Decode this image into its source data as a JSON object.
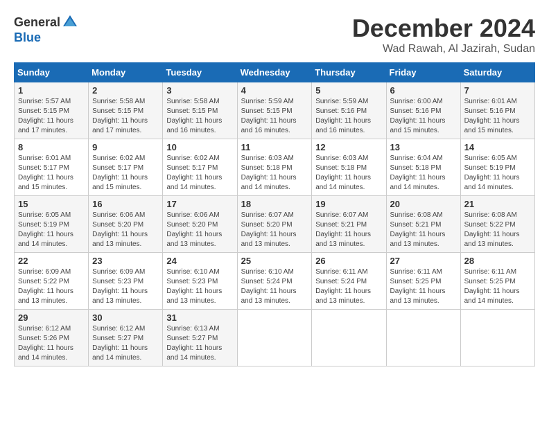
{
  "header": {
    "logo_general": "General",
    "logo_blue": "Blue",
    "month_title": "December 2024",
    "location": "Wad Rawah, Al Jazirah, Sudan"
  },
  "calendar": {
    "days_of_week": [
      "Sunday",
      "Monday",
      "Tuesday",
      "Wednesday",
      "Thursday",
      "Friday",
      "Saturday"
    ],
    "weeks": [
      [
        {
          "day": "1",
          "info": "Sunrise: 5:57 AM\nSunset: 5:15 PM\nDaylight: 11 hours and 17 minutes."
        },
        {
          "day": "2",
          "info": "Sunrise: 5:58 AM\nSunset: 5:15 PM\nDaylight: 11 hours and 17 minutes."
        },
        {
          "day": "3",
          "info": "Sunrise: 5:58 AM\nSunset: 5:15 PM\nDaylight: 11 hours and 16 minutes."
        },
        {
          "day": "4",
          "info": "Sunrise: 5:59 AM\nSunset: 5:15 PM\nDaylight: 11 hours and 16 minutes."
        },
        {
          "day": "5",
          "info": "Sunrise: 5:59 AM\nSunset: 5:16 PM\nDaylight: 11 hours and 16 minutes."
        },
        {
          "day": "6",
          "info": "Sunrise: 6:00 AM\nSunset: 5:16 PM\nDaylight: 11 hours and 15 minutes."
        },
        {
          "day": "7",
          "info": "Sunrise: 6:01 AM\nSunset: 5:16 PM\nDaylight: 11 hours and 15 minutes."
        }
      ],
      [
        {
          "day": "8",
          "info": "Sunrise: 6:01 AM\nSunset: 5:17 PM\nDaylight: 11 hours and 15 minutes."
        },
        {
          "day": "9",
          "info": "Sunrise: 6:02 AM\nSunset: 5:17 PM\nDaylight: 11 hours and 15 minutes."
        },
        {
          "day": "10",
          "info": "Sunrise: 6:02 AM\nSunset: 5:17 PM\nDaylight: 11 hours and 14 minutes."
        },
        {
          "day": "11",
          "info": "Sunrise: 6:03 AM\nSunset: 5:18 PM\nDaylight: 11 hours and 14 minutes."
        },
        {
          "day": "12",
          "info": "Sunrise: 6:03 AM\nSunset: 5:18 PM\nDaylight: 11 hours and 14 minutes."
        },
        {
          "day": "13",
          "info": "Sunrise: 6:04 AM\nSunset: 5:18 PM\nDaylight: 11 hours and 14 minutes."
        },
        {
          "day": "14",
          "info": "Sunrise: 6:05 AM\nSunset: 5:19 PM\nDaylight: 11 hours and 14 minutes."
        }
      ],
      [
        {
          "day": "15",
          "info": "Sunrise: 6:05 AM\nSunset: 5:19 PM\nDaylight: 11 hours and 14 minutes."
        },
        {
          "day": "16",
          "info": "Sunrise: 6:06 AM\nSunset: 5:20 PM\nDaylight: 11 hours and 13 minutes."
        },
        {
          "day": "17",
          "info": "Sunrise: 6:06 AM\nSunset: 5:20 PM\nDaylight: 11 hours and 13 minutes."
        },
        {
          "day": "18",
          "info": "Sunrise: 6:07 AM\nSunset: 5:20 PM\nDaylight: 11 hours and 13 minutes."
        },
        {
          "day": "19",
          "info": "Sunrise: 6:07 AM\nSunset: 5:21 PM\nDaylight: 11 hours and 13 minutes."
        },
        {
          "day": "20",
          "info": "Sunrise: 6:08 AM\nSunset: 5:21 PM\nDaylight: 11 hours and 13 minutes."
        },
        {
          "day": "21",
          "info": "Sunrise: 6:08 AM\nSunset: 5:22 PM\nDaylight: 11 hours and 13 minutes."
        }
      ],
      [
        {
          "day": "22",
          "info": "Sunrise: 6:09 AM\nSunset: 5:22 PM\nDaylight: 11 hours and 13 minutes."
        },
        {
          "day": "23",
          "info": "Sunrise: 6:09 AM\nSunset: 5:23 PM\nDaylight: 11 hours and 13 minutes."
        },
        {
          "day": "24",
          "info": "Sunrise: 6:10 AM\nSunset: 5:23 PM\nDaylight: 11 hours and 13 minutes."
        },
        {
          "day": "25",
          "info": "Sunrise: 6:10 AM\nSunset: 5:24 PM\nDaylight: 11 hours and 13 minutes."
        },
        {
          "day": "26",
          "info": "Sunrise: 6:11 AM\nSunset: 5:24 PM\nDaylight: 11 hours and 13 minutes."
        },
        {
          "day": "27",
          "info": "Sunrise: 6:11 AM\nSunset: 5:25 PM\nDaylight: 11 hours and 13 minutes."
        },
        {
          "day": "28",
          "info": "Sunrise: 6:11 AM\nSunset: 5:25 PM\nDaylight: 11 hours and 14 minutes."
        }
      ],
      [
        {
          "day": "29",
          "info": "Sunrise: 6:12 AM\nSunset: 5:26 PM\nDaylight: 11 hours and 14 minutes."
        },
        {
          "day": "30",
          "info": "Sunrise: 6:12 AM\nSunset: 5:27 PM\nDaylight: 11 hours and 14 minutes."
        },
        {
          "day": "31",
          "info": "Sunrise: 6:13 AM\nSunset: 5:27 PM\nDaylight: 11 hours and 14 minutes."
        },
        {
          "day": "",
          "info": ""
        },
        {
          "day": "",
          "info": ""
        },
        {
          "day": "",
          "info": ""
        },
        {
          "day": "",
          "info": ""
        }
      ]
    ]
  }
}
